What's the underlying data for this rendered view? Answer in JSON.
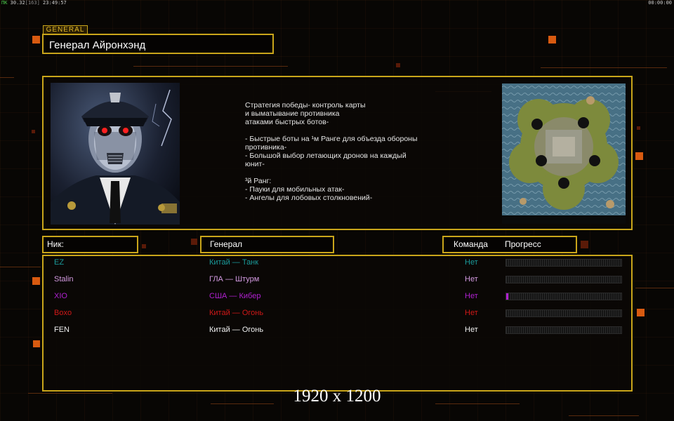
{
  "status_bar": {
    "left_prefix": "",
    "left_ok": "ПК",
    "left_rest": " 30.32",
    "left_dim": "[163]",
    "left_time": " 23:49:57",
    "right_time": "00:00:00"
  },
  "general": {
    "tag": "GENERAL",
    "name": "Генерал Айронхэнд",
    "strategy": "Стратегия победы- контроль карты\nи выматывание противника\nатаками быстрых ботов-\n\n- Быстрые боты на ¹м Ранге для объезда обороны\n  противника-\n- Большой выбор летающих дронов на каждый\n  юнит-\n\n³й Ранг:\n- Пауки для мобильных атак-\n- Ангелы для лобовых столкновений-",
    "portrait_icon": "robot-general-portrait",
    "map_icon": "island-map-preview"
  },
  "headers": {
    "nick": "Ник:",
    "general": "Генерал",
    "team": "Команда",
    "progress": "Прогресс"
  },
  "players": [
    {
      "nick": "EZ",
      "general": "Китай — Танк",
      "team": "Нет",
      "color": "#1a9a9a",
      "progress": 0
    },
    {
      "nick": "Stalin",
      "general": "ГЛА — Штурм",
      "team": "Нет",
      "color": "#d39ae0",
      "progress": 0
    },
    {
      "nick": "XIO",
      "general": "США — Кибер",
      "team": "Нет",
      "color": "#b020d0",
      "progress": 0.02
    },
    {
      "nick": "Boxo",
      "general": "Китай — Огонь",
      "team": "Нет",
      "color": "#d01818",
      "progress": 0
    },
    {
      "nick": "FEN",
      "general": "Китай — Огонь",
      "team": "Нет",
      "color": "#f0f0f0",
      "progress": 0
    }
  ],
  "resolution_label": "1920 x 1200",
  "colors": {
    "frame_gold": "#c9a51a",
    "accent_orange": "#d85a10"
  }
}
